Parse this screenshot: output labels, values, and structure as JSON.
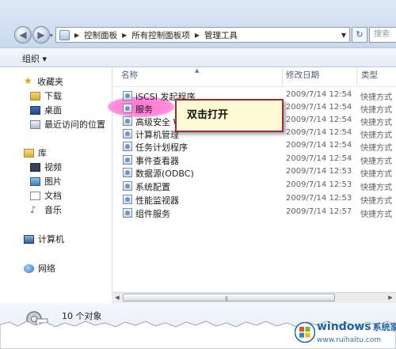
{
  "window": {
    "address": {
      "crumbs": [
        "控制面板",
        "所有控制面板项",
        "管理工具"
      ],
      "search_placeholder": "搜索"
    },
    "toolbar": {
      "organize": "组织 ▾"
    },
    "nav": {
      "favorites_header": "收藏夹",
      "favorites": [
        "下载",
        "桌面",
        "最近访问的位置"
      ],
      "libraries_header": "库",
      "libraries": [
        "视频",
        "图片",
        "文档",
        "音乐"
      ],
      "computer": "计算机",
      "network": "网络"
    },
    "columns": {
      "name": "名称",
      "date": "修改日期",
      "type": "类型"
    },
    "files": [
      {
        "name": "iSCSI 发起程序",
        "date": "2009/7/14 12:54",
        "type": "快捷方式"
      },
      {
        "name": "服务",
        "date": "2009/7/14 12:54",
        "type": "快捷方式"
      },
      {
        "name": "高级安全 Wi",
        "date": "2009/7/14 12:54",
        "type": "快捷方式"
      },
      {
        "name": "计算机管理",
        "date": "2009/7/14 12:54",
        "type": "快捷方式"
      },
      {
        "name": "任务计划程序",
        "date": "2009/7/14 12:54",
        "type": "快捷方式"
      },
      {
        "name": "事件查看器",
        "date": "2009/7/14 12:54",
        "type": "快捷方式"
      },
      {
        "name": "数据源(ODBC)",
        "date": "2009/7/14 12:53",
        "type": "快捷方式"
      },
      {
        "name": "系统配置",
        "date": "2009/7/14 12:53",
        "type": "快捷方式"
      },
      {
        "name": "性能监视器",
        "date": "2009/7/14 12:53",
        "type": "快捷方式"
      },
      {
        "name": "组件服务",
        "date": "2009/7/14 12:57",
        "type": "快捷方式"
      }
    ],
    "callout": "双击打开",
    "status": {
      "count": "10 个对象"
    }
  },
  "watermark": {
    "brand": "windows",
    "brand_cn": "系统家园",
    "url": "www.ruihaitu.com"
  },
  "colors": {
    "accent": "#1a61b0",
    "highlight": "#ff69cd",
    "callout_border": "#a2273b"
  }
}
